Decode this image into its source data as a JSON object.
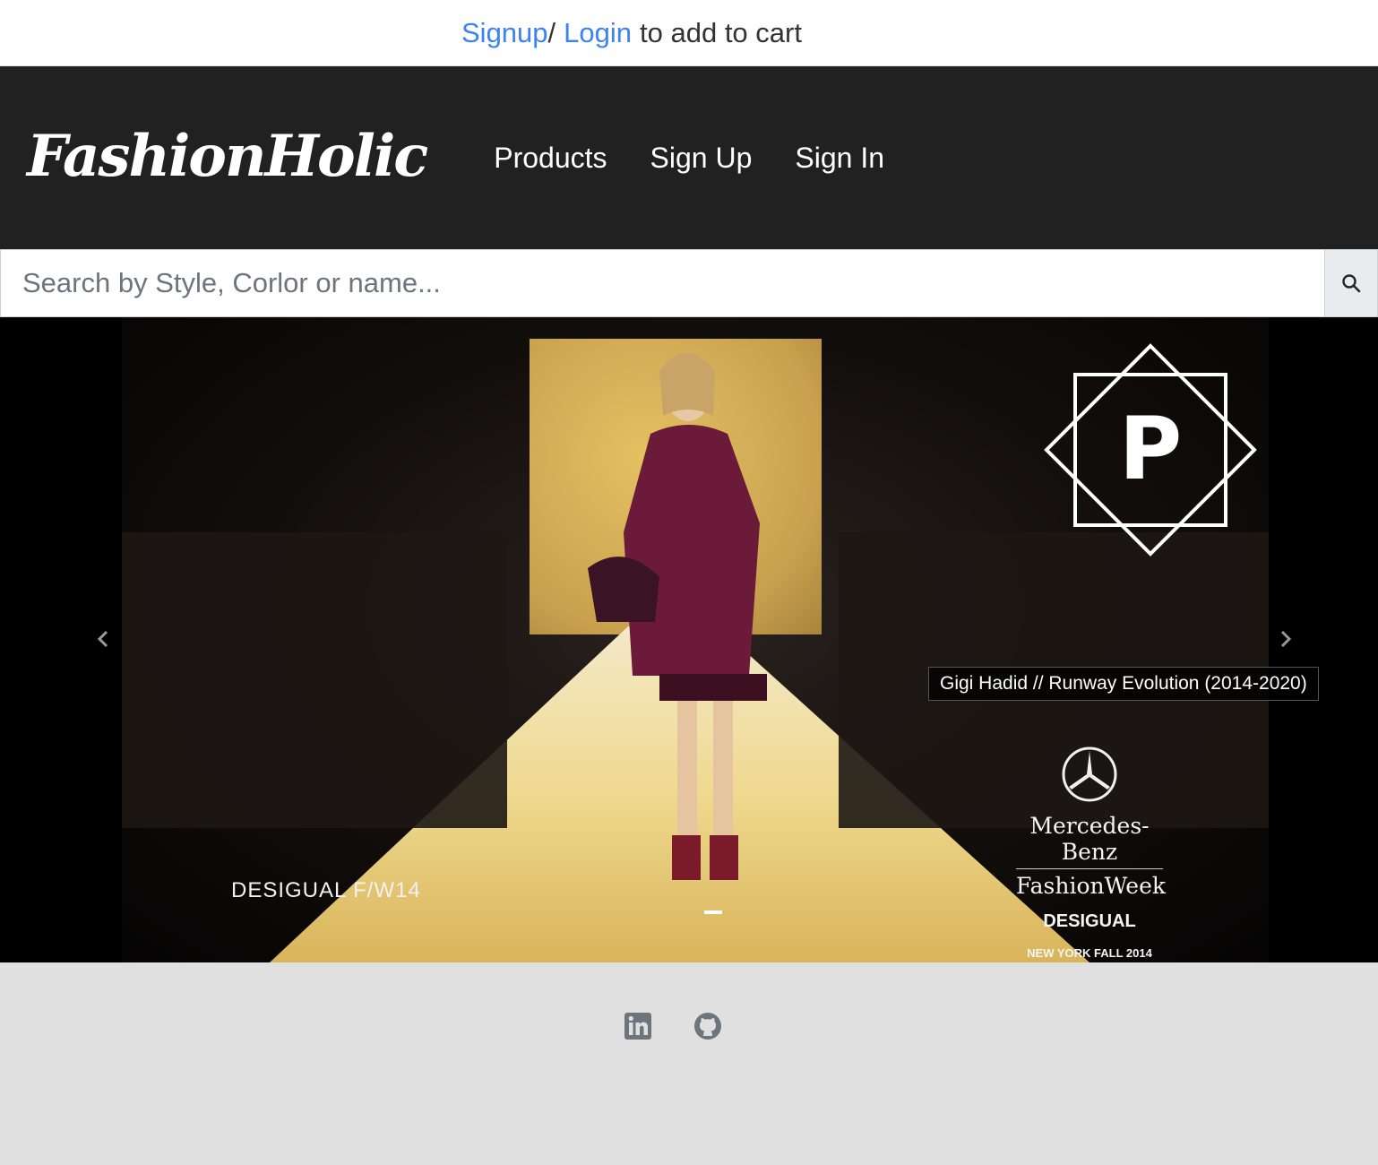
{
  "topbar": {
    "signup_link": "Signup",
    "separator": "/",
    "login_link": "Login",
    "message": "to add to cart"
  },
  "navbar": {
    "brand": "FashionHolic",
    "links": [
      "Products",
      "Sign Up",
      "Sign In"
    ]
  },
  "search": {
    "placeholder": "Search by Style, Corlor or name...",
    "button_icon": "search-icon"
  },
  "carousel": {
    "video_title": "Gigi Hadid // Runway Evolution (2014-2020)",
    "slide_caption": "DESIGUAL F/W14",
    "sponsor_line1": "Mercedes-Benz",
    "sponsor_line2": "FashionWeek",
    "sponsor_line3": "DESIGUAL",
    "sponsor_line4": "NEW YORK FALL 2014",
    "logo_letter": "P",
    "prev_icon": "chevron-left-icon",
    "next_icon": "chevron-right-icon"
  },
  "footer": {
    "icons": [
      "linkedin-icon",
      "github-icon"
    ]
  },
  "colors": {
    "link": "#3b82f6",
    "navbar_bg": "#212121",
    "footer_bg": "#e0e0e0"
  }
}
